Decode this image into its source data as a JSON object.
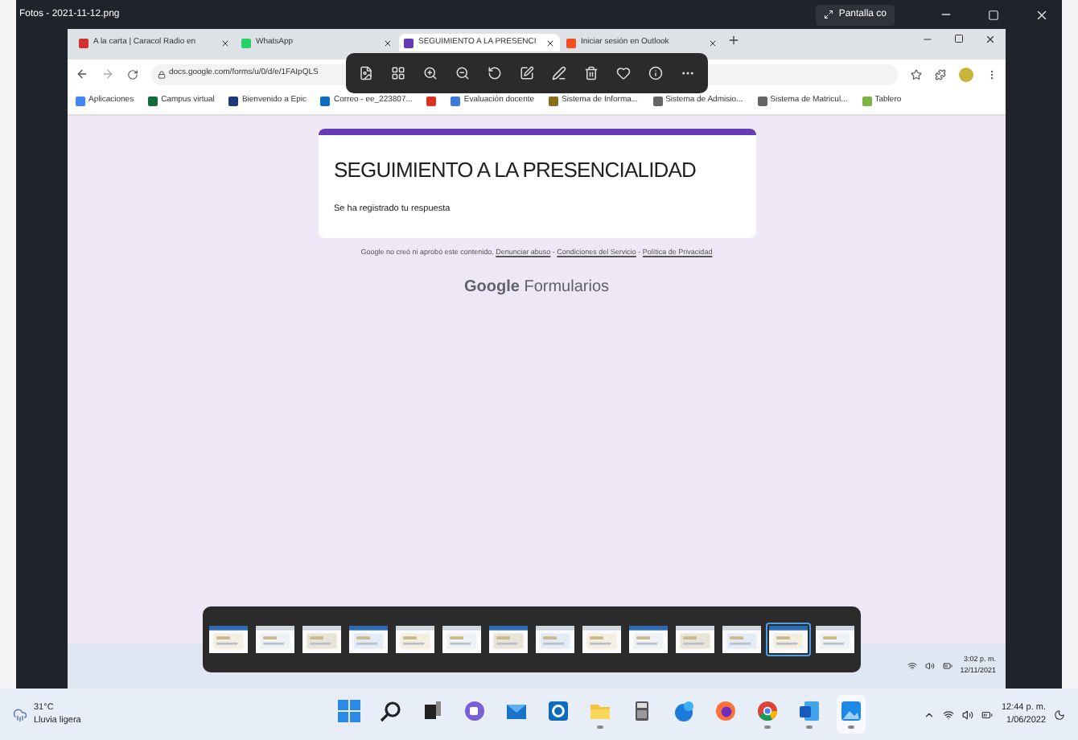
{
  "window": {
    "title": "Fotos - 2021-11-12.png",
    "fullscreen_button": "Pantalla co"
  },
  "browser": {
    "tabs": [
      {
        "label": "A la carta | Caracol Radio en",
        "selected": false
      },
      {
        "label": "WhatsApp",
        "selected": false
      },
      {
        "label": "SEGUIMIENTO A LA PRESENCI",
        "selected": true
      },
      {
        "label": "Iniciar sesión en Outlook",
        "selected": false
      }
    ],
    "url": "docs.google.com/forms/u/0/d/e/1FAIpQLS",
    "bookmarks": [
      {
        "kind": "link",
        "label": "Aplicaciones"
      },
      {
        "kind": "link",
        "label": "Campus virtual"
      },
      {
        "kind": "link",
        "label": "Bienvenido a Epic"
      },
      {
        "kind": "link",
        "label": "Correo - ee_223807..."
      },
      {
        "kind": "icon"
      },
      {
        "kind": "link",
        "label": "Evaluación docente"
      },
      {
        "kind": "link",
        "label": "Sistema de Informa..."
      },
      {
        "kind": "link",
        "label": "Sistema de Admisio..."
      },
      {
        "kind": "link",
        "label": "Sistema de Matricul..."
      },
      {
        "kind": "link",
        "label": "Tablero"
      }
    ],
    "form": {
      "title": "SEGUIMIENTO A LA PRESENCIALIDAD",
      "message": "Se ha registrado tu respuesta",
      "disclaimer": "Google no creó ni aprobó este contenido.",
      "links": [
        "Denunciar abuso",
        "Condiciones del Servicio",
        "Política de Privacidad"
      ],
      "link_separator": "-",
      "brand_bold": "Google",
      "brand": "Formularios"
    },
    "inner_clock": {
      "time": "3:02 p. m.",
      "date": "12/11/2021"
    }
  },
  "filmstrip": [
    {
      "selected": false
    },
    {
      "selected": false
    },
    {
      "selected": false
    },
    {
      "selected": false
    },
    {
      "selected": false
    },
    {
      "selected": false
    },
    {
      "selected": false
    },
    {
      "selected": false
    },
    {
      "selected": false
    },
    {
      "selected": false
    },
    {
      "selected": false
    },
    {
      "selected": false
    },
    {
      "selected": true
    },
    {
      "selected": false
    }
  ],
  "taskbar": {
    "weather": {
      "temperature": "31°C",
      "condition": "Lluvia ligera"
    },
    "apps": [
      {
        "kind": "start",
        "active": false
      },
      {
        "kind": "search",
        "active": false
      },
      {
        "kind": "taskview",
        "active": false
      },
      {
        "kind": "chat",
        "active": false
      },
      {
        "kind": "mail",
        "active": false
      },
      {
        "kind": "outlook",
        "active": false
      },
      {
        "kind": "folder",
        "active": true
      },
      {
        "kind": "calculator",
        "active": false
      },
      {
        "kind": "edge",
        "active": false
      },
      {
        "kind": "firefox",
        "active": false
      },
      {
        "kind": "chrome",
        "active": true
      },
      {
        "kind": "word",
        "active": true
      },
      {
        "kind": "photos",
        "active": true
      }
    ],
    "time": "12:44 p. m.",
    "date": "1/06/2022"
  }
}
